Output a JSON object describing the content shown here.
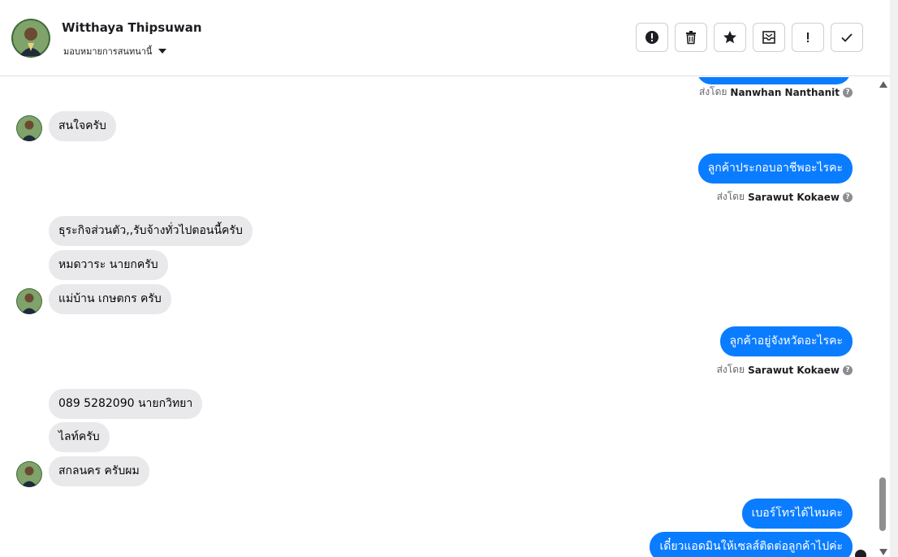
{
  "header": {
    "contact_name": "Witthaya Thipsuwan",
    "assign_label": "มอบหมายการสนทนานี้",
    "actions": [
      {
        "name": "spam-icon",
        "label": "spam"
      },
      {
        "name": "trash-icon",
        "label": "delete"
      },
      {
        "name": "star-icon",
        "label": "star"
      },
      {
        "name": "mark-unread-icon",
        "label": "mark unread"
      },
      {
        "name": "exclamation-icon",
        "label": "!"
      },
      {
        "name": "checkmark-icon",
        "label": "done"
      }
    ]
  },
  "sent_by_prefix": "ส่งโดย",
  "messages": [
    {
      "dir": "out",
      "sender": "Nanwhan Nanthanit"
    },
    {
      "dir": "in",
      "text": "สนใจครับ"
    },
    {
      "dir": "out",
      "text": "ลูกค้าประกอบอาชีพอะไรคะ",
      "sender": "Sarawut Kokaew"
    },
    {
      "dir": "in",
      "text": "ธุระกิจส่วนตัว,,รับจ้างทั่วไปตอนนี้ครับ"
    },
    {
      "dir": "in",
      "text": "หมดวาระ  นายกครับ"
    },
    {
      "dir": "in",
      "text": "แม่บ้าน  เกษตกร  ครับ"
    },
    {
      "dir": "out",
      "text": "ลูกค้าอยู่จังหวัดอะไรคะ",
      "sender": "Sarawut Kokaew"
    },
    {
      "dir": "in",
      "text": "089 5282090 นายกวิทยา"
    },
    {
      "dir": "in",
      "text": "ไลท์ครับ"
    },
    {
      "dir": "in",
      "text": "สกลนคร  ครับผม"
    },
    {
      "dir": "out",
      "text": "เบอร์โทรได้ไหมคะ"
    },
    {
      "dir": "out",
      "text": "เดี๋ยวแอดมินให้เซลส์ติดต่อลูกค้าไปค่ะ"
    }
  ],
  "colors": {
    "outgoing_bubble": "#0a7cff",
    "incoming_bubble": "#e9e9eb"
  }
}
